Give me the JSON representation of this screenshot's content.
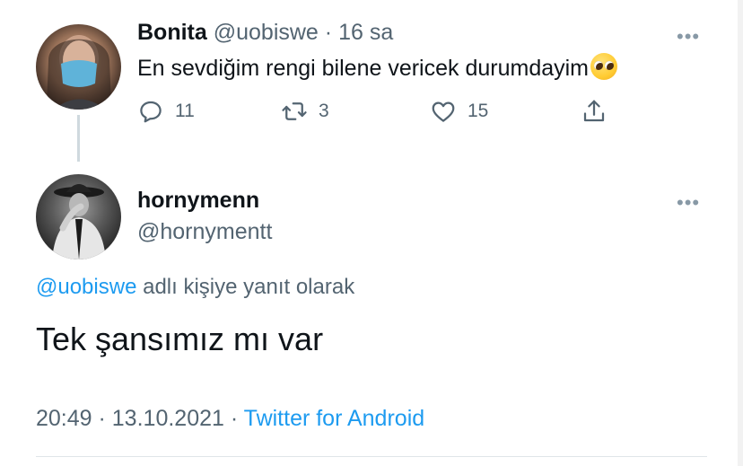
{
  "parent_tweet": {
    "name": "Bonita",
    "handle": "@uobiswe",
    "separator": "·",
    "time": "16 sa",
    "text": "En sevdiğim rengi bilene vericek durumdayim",
    "emoji": "pleading-face",
    "more": "•••",
    "actions": {
      "replies": "11",
      "retweets": "3",
      "likes": "15"
    }
  },
  "reply_tweet": {
    "name": "hornymenn",
    "handle": "@hornymentt",
    "more": "•••",
    "reply_to_handle": "@uobiswe",
    "reply_to_suffix": " adlı kişiye yanıt olarak",
    "text": "Tek şansımız mı var",
    "time": "20:49",
    "separator": " · ",
    "date": "13.10.2021",
    "source": "Twitter for Android"
  },
  "colors": {
    "text": "#0f1419",
    "secondary": "#536471",
    "link": "#1d9bf0",
    "thread_line": "#cfd9de"
  }
}
